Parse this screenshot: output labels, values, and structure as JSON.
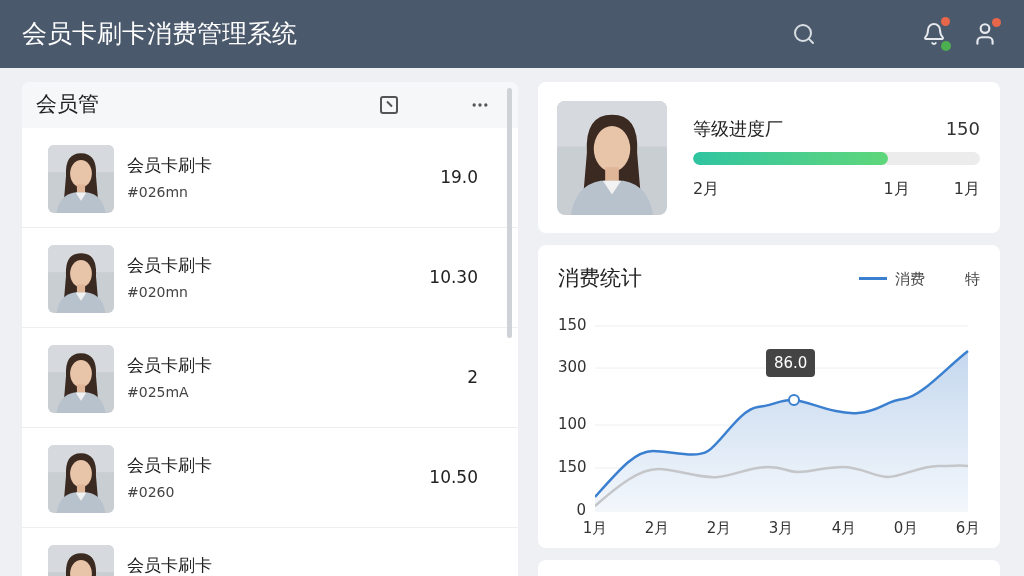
{
  "header": {
    "title": "会员卡刷卡消费管理系统"
  },
  "member_panel": {
    "title": "会员管",
    "rows": [
      {
        "name": "会员卡刷卡",
        "card_no": "#026mn",
        "amount": "19.0"
      },
      {
        "name": "会员卡刷卡",
        "card_no": "#020mn",
        "amount": "10.30"
      },
      {
        "name": "会员卡刷卡",
        "card_no": "#025mA",
        "amount": "2"
      },
      {
        "name": "会员卡刷卡",
        "card_no": "#0260",
        "amount": "10.50"
      },
      {
        "name": "会员卡刷卡"
      }
    ]
  },
  "level_card": {
    "label": "等级进度厂",
    "value": "150",
    "level": 0.68,
    "marks": [
      "2月",
      "1月",
      "1月"
    ]
  },
  "stats_card": {
    "title": "消费统计",
    "legend": [
      {
        "label": "消费",
        "color": "#3a7fd0"
      },
      {
        "label": "特"
      }
    ],
    "y_axis_labels": [
      "150",
      "300",
      "100",
      "150",
      "0"
    ],
    "x_axis_labels": [
      "1月",
      "2月",
      "2月",
      "3月",
      "4月",
      "0月",
      "6月"
    ],
    "tooltip": "86.0"
  }
}
